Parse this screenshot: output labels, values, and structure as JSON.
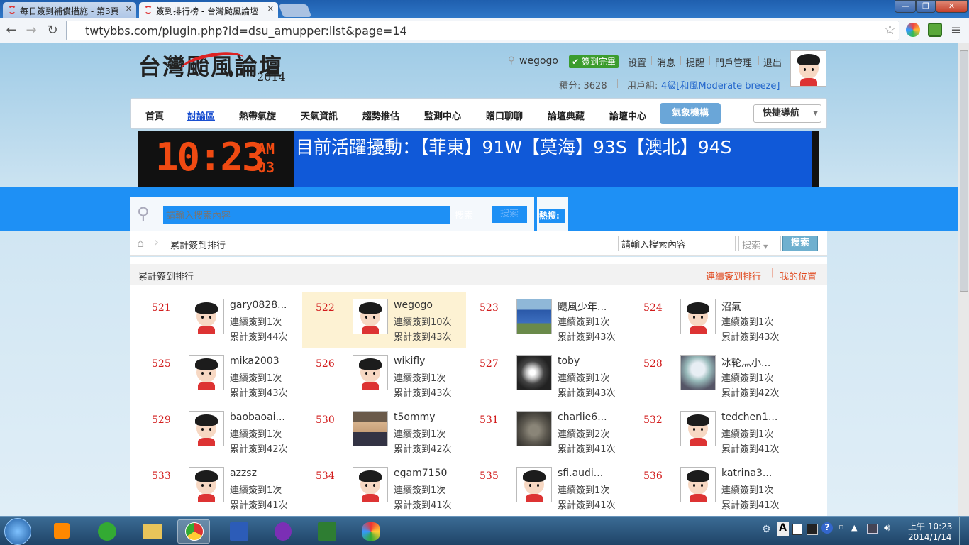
{
  "browser": {
    "tabs": [
      {
        "title": "每日簽到補償措施 - 第3頁"
      },
      {
        "title": "簽到排行榜 - 台灣颱風論壇"
      }
    ],
    "url": "twtybbs.com/plugin.php?id=dsu_amupper:list&page=14",
    "window_buttons": {
      "minimize": "—",
      "restore": "❐",
      "close": "✕"
    }
  },
  "header": {
    "logo": "台灣颱風論壇",
    "logo_year": "2014",
    "username": "wegogo",
    "checkin_badge": "簽到完畢",
    "links": [
      "設置",
      "消息",
      "提醒",
      "門戶管理",
      "退出"
    ],
    "points_label": "積分: 3628",
    "group_label": "用戶組:",
    "group_value": "4級[和風Moderate breeze]"
  },
  "nav": {
    "items": [
      "首頁",
      "討論區",
      "熱帶氣旋",
      "天氣資訊",
      "趨勢推估",
      "監測中心",
      "贈口聊聊",
      "論壇典藏",
      "論壇中心"
    ],
    "active": "氣象機構",
    "quick": "快捷導航"
  },
  "banner": {
    "clock_time": "10:23",
    "clock_ampm": "AM",
    "clock_sec": "03",
    "text": "目前活躍擾動：【菲東】91W【莫海】93S【澳北】94S"
  },
  "search": {
    "placeholder": "請輸入搜索內容",
    "type": "搜索",
    "button": "搜索",
    "hot_label": "熱搜:"
  },
  "breadcrumb": {
    "current": "累計簽到排行",
    "search_value": "請輸入搜索內容",
    "select": "搜索",
    "button": "搜索"
  },
  "section": {
    "title": "累計簽到排行",
    "link_continuous": "連續簽到排行",
    "link_mine": "我的位置"
  },
  "rankings": [
    {
      "rank": "521",
      "name": "gary0828...",
      "cont": "連續簽到1次",
      "total": "累計簽到44次",
      "avatar": "default-avatar"
    },
    {
      "rank": "522",
      "name": "wegogo",
      "cont": "連續簽到10次",
      "total": "累計簽到43次",
      "avatar": "default-avatar",
      "me": true
    },
    {
      "rank": "523",
      "name": "颶風少年...",
      "cont": "連續簽到1次",
      "total": "累計簽到43次",
      "avatar": "group-photo-avatar"
    },
    {
      "rank": "524",
      "name": "沼氣",
      "cont": "連續簽到1次",
      "total": "累計簽到43次",
      "avatar": "default-avatar"
    },
    {
      "rank": "525",
      "name": "mika2003",
      "cont": "連續簽到1次",
      "total": "累計簽到43次",
      "avatar": "default-avatar"
    },
    {
      "rank": "526",
      "name": "wikifly",
      "cont": "連續簽到1次",
      "total": "累計簽到43次",
      "avatar": "default-avatar"
    },
    {
      "rank": "527",
      "name": "toby",
      "cont": "連續簽到1次",
      "total": "累計簽到43次",
      "avatar": "typhoon-satellite-avatar"
    },
    {
      "rank": "528",
      "name": "冰轮灬小...",
      "cont": "連續簽到1次",
      "total": "累計簽到42次",
      "avatar": "anime-avatar"
    },
    {
      "rank": "529",
      "name": "baobaoai...",
      "cont": "連續簽到1次",
      "total": "累計簽到42次",
      "avatar": "default-avatar"
    },
    {
      "rank": "530",
      "name": "t5ommy",
      "cont": "連續簽到1次",
      "total": "累計簽到42次",
      "avatar": "photo-avatar"
    },
    {
      "rank": "531",
      "name": "charlie6...",
      "cont": "連續簽到2次",
      "total": "累計簽到41次",
      "avatar": "cat-avatar"
    },
    {
      "rank": "532",
      "name": "tedchen1...",
      "cont": "連續簽到1次",
      "total": "累計簽到41次",
      "avatar": "default-avatar"
    },
    {
      "rank": "533",
      "name": "azzsz",
      "cont": "連續簽到1次",
      "total": "累計簽到41次",
      "avatar": "default-avatar"
    },
    {
      "rank": "534",
      "name": "egam7150",
      "cont": "連續簽到1次",
      "total": "累計簽到41次",
      "avatar": "default-avatar"
    },
    {
      "rank": "535",
      "name": "sfi.audi...",
      "cont": "連續簽到1次",
      "total": "累計簽到41次",
      "avatar": "default-avatar"
    },
    {
      "rank": "536",
      "name": "katrina3...",
      "cont": "連續簽到1次",
      "total": "累計簽到41次",
      "avatar": "default-avatar"
    }
  ],
  "taskbar": {
    "clock_ampm": "上午 10:23",
    "date": "2014/1/14",
    "ime": "A"
  },
  "colors": {
    "rank_red": "#d21c1c",
    "link_orange": "#e0461b",
    "banner_blue": "#1059d8",
    "search_band": "#1e90f5",
    "highlight": "#fdf2d3"
  }
}
